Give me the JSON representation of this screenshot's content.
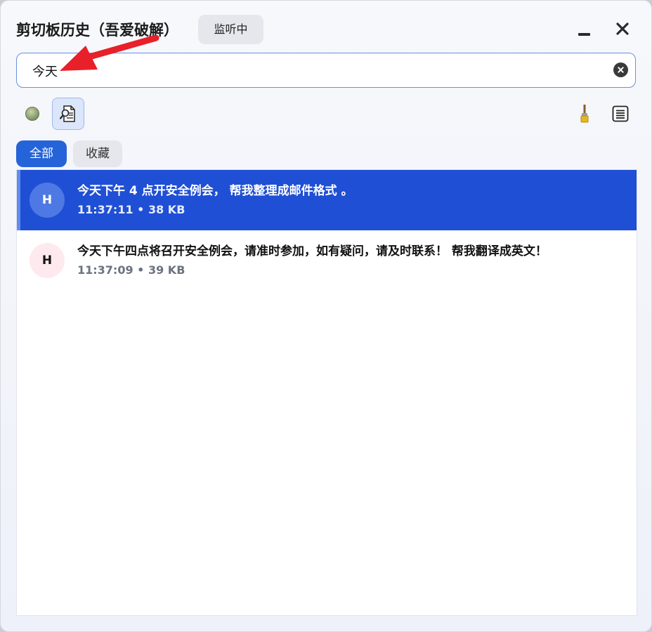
{
  "window": {
    "title": "剪切板历史（吾爱破解）",
    "status_badge": "监听中"
  },
  "search": {
    "value": "今天",
    "placeholder": ""
  },
  "toolbar": {
    "status_dot_color": "#8a9d6c",
    "icons": [
      "status-dot-icon",
      "search-document-icon",
      "brush-icon",
      "list-icon"
    ]
  },
  "tabs": [
    {
      "label": "全部",
      "active": true
    },
    {
      "label": "收藏",
      "active": false
    }
  ],
  "items": [
    {
      "avatar": "H",
      "text": "今天下午 4 点开安全例会， 帮我整理成邮件格式 。",
      "meta": "11:37:11 • 38 KB",
      "selected": true
    },
    {
      "avatar": "H",
      "text": "今天下午四点将召开安全例会，请准时参加，如有疑问，请及时联系！ 帮我翻译成英文！",
      "meta": "11:37:09 • 39 KB",
      "selected": false
    }
  ],
  "colors": {
    "accent": "#2563d9",
    "selected_row": "#1f4fd4",
    "annotation_arrow": "#e8202a"
  }
}
